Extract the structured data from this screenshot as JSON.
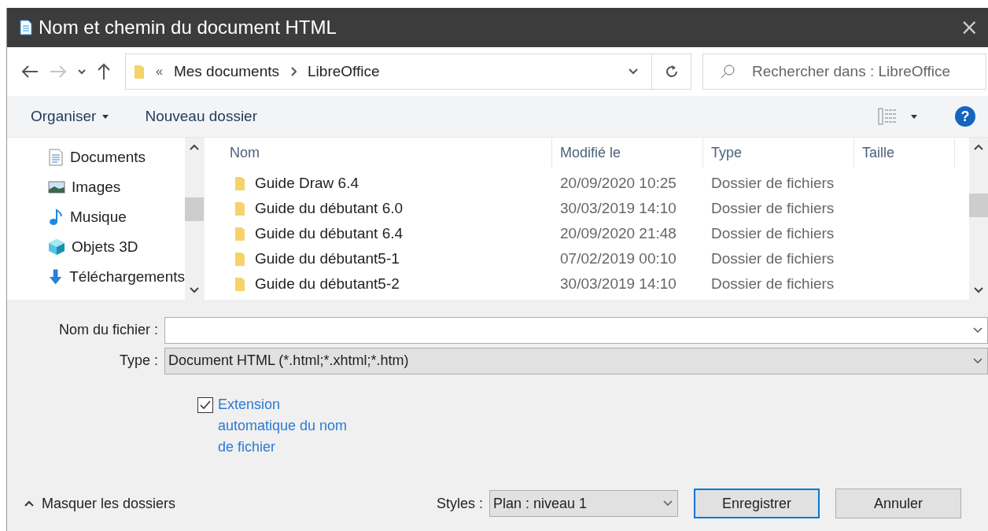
{
  "window": {
    "title": "Nom et chemin du document HTML",
    "close": "×"
  },
  "nav": {
    "breadcrumb_prefix": "«",
    "path": [
      {
        "label": "Mes documents"
      },
      {
        "label": "LibreOffice"
      }
    ],
    "search": {
      "placeholder": "Rechercher dans : LibreOffice"
    }
  },
  "toolbar": {
    "organise": "Organiser",
    "new_folder": "Nouveau dossier",
    "help": "?"
  },
  "sidebar": {
    "items": [
      {
        "label": "Documents",
        "kind": "documents"
      },
      {
        "label": "Images",
        "kind": "images"
      },
      {
        "label": "Musique",
        "kind": "music"
      },
      {
        "label": "Objets 3D",
        "kind": "objects3d"
      },
      {
        "label": "Téléchargements",
        "kind": "downloads"
      }
    ]
  },
  "table": {
    "columns": [
      "Nom",
      "Modifié le",
      "Type",
      "Taille"
    ],
    "rows": [
      {
        "name": "Guide Draw 6.4",
        "modified": "20/09/2020 10:25",
        "type": "Dossier de fichiers"
      },
      {
        "name": "Guide du débutant 6.0",
        "modified": "30/03/2019 14:10",
        "type": "Dossier de fichiers"
      },
      {
        "name": "Guide du débutant 6.4",
        "modified": "20/09/2020 21:48",
        "type": "Dossier de fichiers"
      },
      {
        "name": "Guide du débutant5-1",
        "modified": "07/02/2019 00:10",
        "type": "Dossier de fichiers"
      },
      {
        "name": "Guide du débutant5-2",
        "modified": "30/03/2019 14:10",
        "type": "Dossier de fichiers"
      }
    ]
  },
  "form": {
    "filename_label": "Nom du fichier :",
    "type_label": "Type :",
    "type_value": "Document HTML (*.html;*.xhtml;*.htm)",
    "auto_extension": {
      "label": "Extension automatique du nom de fichier",
      "checked": true
    },
    "hide_folders": "Masquer les dossiers",
    "styles_label": "Styles :",
    "styles_value": "Plan : niveau 1",
    "buttons": [
      {
        "label": "Enregistrer",
        "default": true
      },
      {
        "label": "Annuler",
        "default": false
      }
    ]
  }
}
